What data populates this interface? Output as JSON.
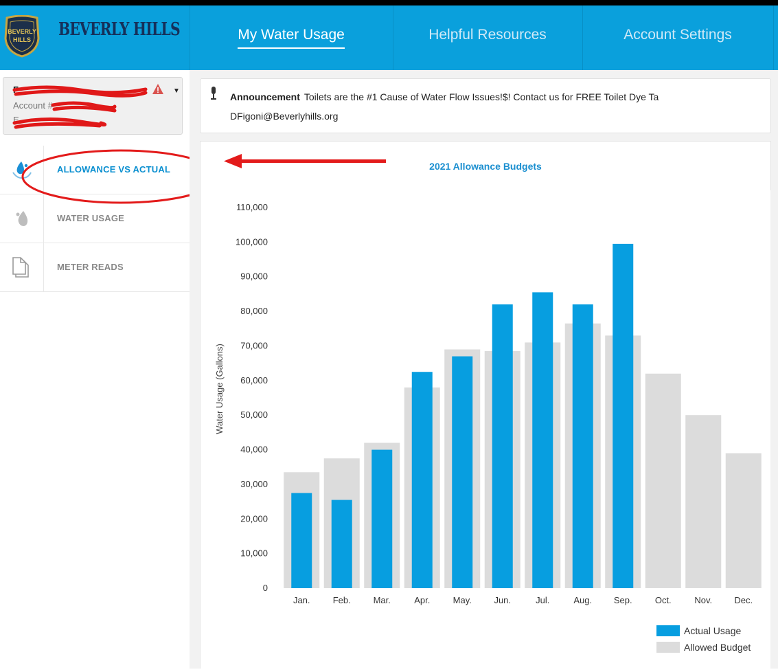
{
  "header": {
    "brand": "BEVERLY HILLS",
    "crest_text": [
      "BEVERLY",
      "HILLS"
    ],
    "nav": [
      {
        "label": "My Water Usage",
        "active": true
      },
      {
        "label": "Helpful Resources",
        "active": false
      },
      {
        "label": "Account Settings",
        "active": false
      }
    ],
    "colors": {
      "bar": "#0aa0dc",
      "brand_text": "#15305a"
    }
  },
  "account": {
    "name": "F",
    "number_label": "Account #:",
    "address": "E"
  },
  "sidebar": {
    "items": [
      {
        "label": "ALLOWANCE VS ACTUAL",
        "icon": "water-drop-hand-icon",
        "active": true
      },
      {
        "label": "WATER USAGE",
        "icon": "water-drops-icon",
        "active": false
      },
      {
        "label": "METER READS",
        "icon": "document-icon",
        "active": false
      }
    ]
  },
  "announcement": {
    "title": "Announcement",
    "text": "Toilets are the #1 Cause of Water Flow Issues!$! Contact us for FREE Toilet Dye Ta",
    "email": "DFigoni@Beverlyhills.org"
  },
  "chart_data": {
    "type": "bar",
    "title": "2021 Allowance Budgets",
    "ylabel": "Water Usage (Gallons)",
    "xlabel": "",
    "categories": [
      "Jan.",
      "Feb.",
      "Mar.",
      "Apr.",
      "May.",
      "Jun.",
      "Jul.",
      "Aug.",
      "Sep.",
      "Oct.",
      "Nov.",
      "Dec."
    ],
    "series": [
      {
        "name": "Allowed Budget",
        "color": "#dcdcdc",
        "values": [
          33500,
          37500,
          42000,
          58000,
          69000,
          68500,
          71000,
          76500,
          73000,
          62000,
          50000,
          39000
        ]
      },
      {
        "name": "Actual Usage",
        "color": "#079ee0",
        "values": [
          27500,
          25500,
          40000,
          62500,
          67000,
          82000,
          85500,
          82000,
          99500,
          null,
          null,
          null
        ]
      }
    ],
    "ylim": [
      0,
      110000
    ],
    "yticks": [
      "0",
      "10,000",
      "20,000",
      "30,000",
      "40,000",
      "50,000",
      "60,000",
      "70,000",
      "80,000",
      "90,000",
      "100,000",
      "110,000"
    ],
    "legend_position": "bottom-right",
    "grid": false
  }
}
